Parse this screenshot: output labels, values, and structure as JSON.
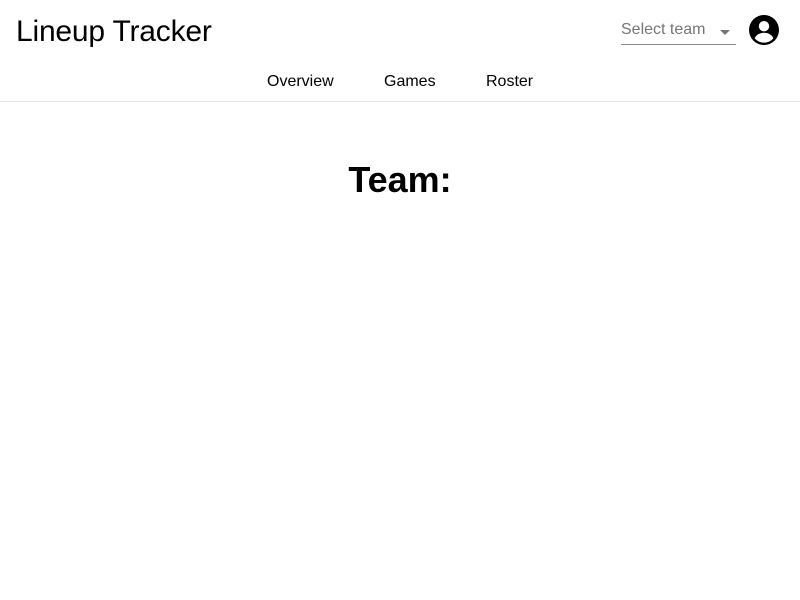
{
  "header": {
    "app_title": "Lineup Tracker",
    "team_select": {
      "placeholder": "Select team",
      "arrow_icon": "arrow-drop-down-icon"
    },
    "account_icon": "account-circle-icon"
  },
  "nav": {
    "tabs": [
      {
        "label": "Overview"
      },
      {
        "label": "Games"
      },
      {
        "label": "Roster"
      }
    ]
  },
  "main": {
    "title": "Team:"
  }
}
